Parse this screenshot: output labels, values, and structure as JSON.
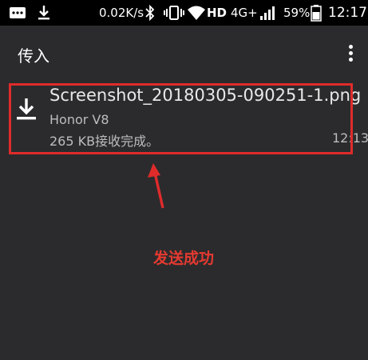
{
  "status_bar": {
    "speed": "0.02K/s",
    "hd_label": "HD",
    "network_label": "4G+",
    "battery_percent": "59%",
    "time": "12:17",
    "icons": [
      "message-icon",
      "download-icon",
      "bluetooth-icon",
      "vibrate-icon",
      "wifi-icon",
      "signal-icon",
      "battery-icon"
    ]
  },
  "app_bar": {
    "title": "传入",
    "menu_icon": "overflow-menu-icon"
  },
  "transfer": {
    "icon": "download-icon",
    "file_name": "Screenshot_20180305-090251-1.png",
    "device": "Honor V8",
    "status": "265 KB接收完成。",
    "time": "12:13"
  },
  "annotation": {
    "text": "发送成功",
    "color": "#e53a30"
  },
  "colors": {
    "background": "#2b2b2d",
    "status_bar": "#000000",
    "highlight": "#e02b2b"
  }
}
